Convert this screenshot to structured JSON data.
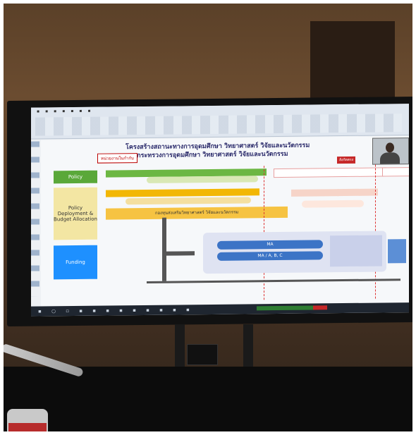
{
  "slide": {
    "title_line1": "โครงสร้างสถานะทางการอุดมศึกษา วิทยาศาสตร์ วิจัยและนวัตกรรม",
    "title_line2": "และกระทรวงการอุดมศึกษา วิทยาศาสตร์ วิจัยและนวัตกรรม",
    "tag_left": "หน่วยงานในกำกับ",
    "tag_right": "สังกัดตรง",
    "row_labels": {
      "policy": "Policy",
      "deployment": "Policy Deployment & Budget Allocation",
      "funding": "Funding"
    },
    "center_bar": "กองทุนส่งเสริมวิทยาศาสตร์ วิจัยและนวัตกรรม",
    "ovals": [
      "MA",
      "MA / A, B, C"
    ]
  },
  "colors": {
    "policy": "#5aa839",
    "deployment": "#f3e6a3",
    "funding": "#1e90ff",
    "oval": "#3c74c6"
  }
}
